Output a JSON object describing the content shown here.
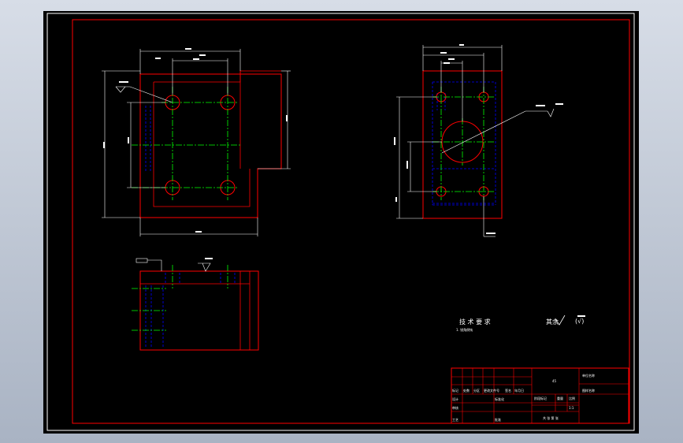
{
  "colors": {
    "background": "#000000",
    "frame": "#ffffff",
    "border": "#ff0000",
    "part": "#ff0000",
    "hidden": "#0000ff",
    "center": "#00ff00",
    "dimension": "#ffffff"
  },
  "drawing": {
    "tech_requirements": {
      "title": "技 术 要 求",
      "line1": "1. 锐角倒钝"
    },
    "roughness_note": {
      "prefix": "其余",
      "suffix": "(√)"
    }
  },
  "title_block": {
    "label_1": "标记",
    "label_2": "处数",
    "label_3": "分区",
    "label_4": "更改文件号",
    "label_5": "签名",
    "label_6": "年月日",
    "label_7": "设计",
    "label_8": "标准化",
    "label_9": "审核",
    "label_10": "工艺",
    "label_11": "批准",
    "label_12": "阶段标记",
    "label_13": "重量",
    "label_14": "比例",
    "label_15": "共 张 第 张",
    "label_16": "1:1",
    "material": "45",
    "company": "单位名称",
    "part_name": "图样名称"
  }
}
